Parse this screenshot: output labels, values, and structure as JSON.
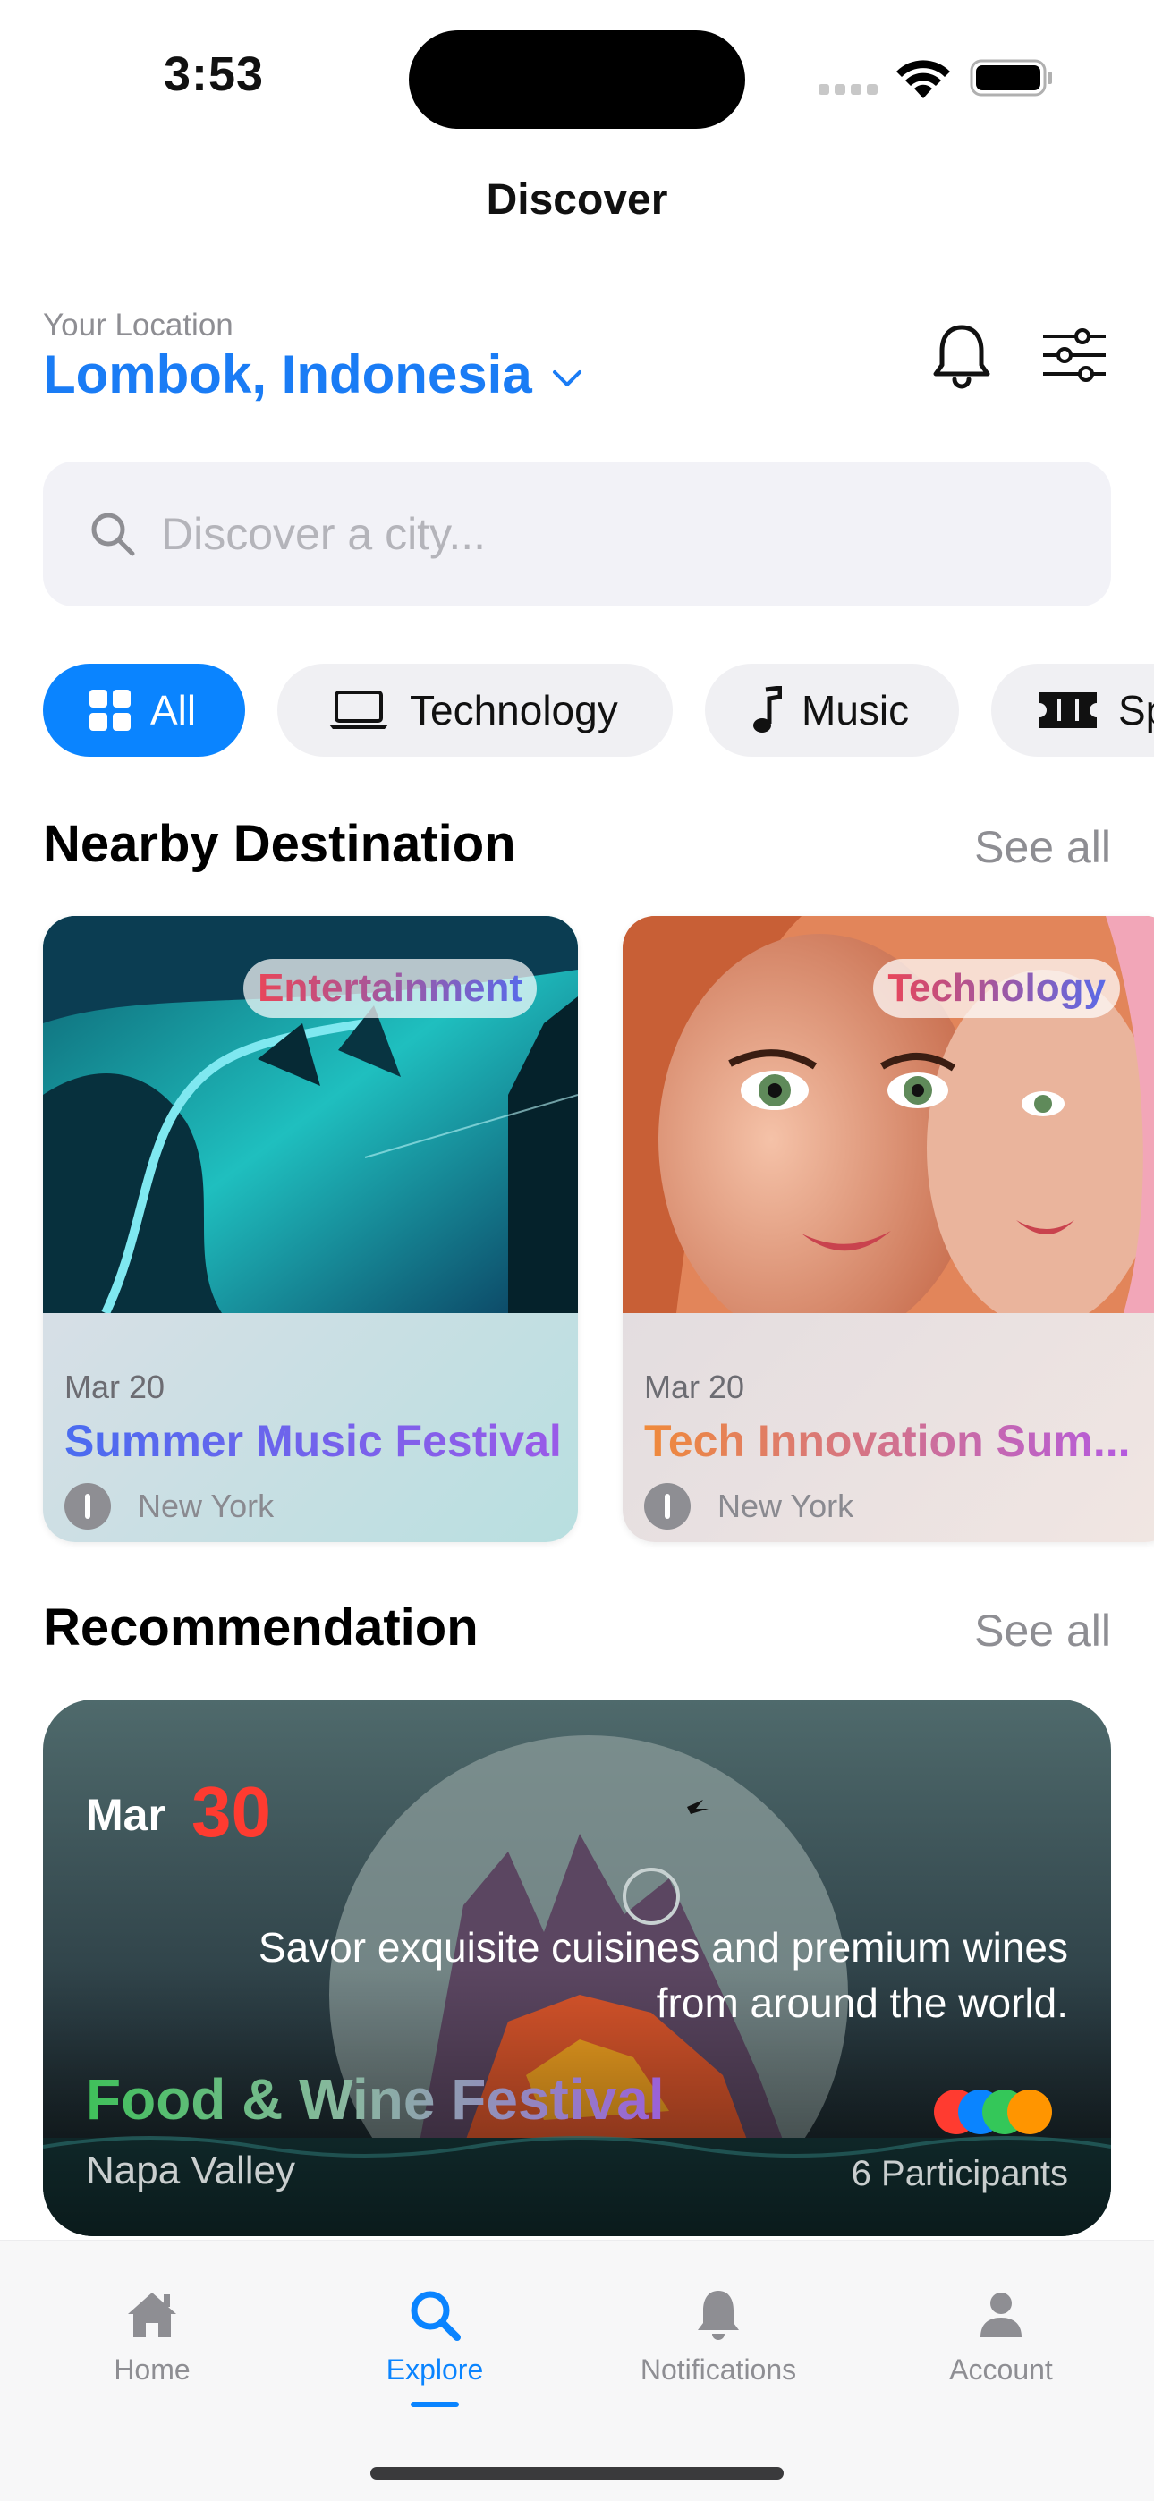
{
  "status_bar": {
    "time": "3:53"
  },
  "nav": {
    "title": "Discover"
  },
  "location": {
    "caption": "Your Location",
    "value": "Lombok, Indonesia"
  },
  "search": {
    "placeholder": "Discover a city..."
  },
  "categories": [
    {
      "label": "All",
      "icon": "grid-icon",
      "active": true
    },
    {
      "label": "Technology",
      "icon": "laptop-icon",
      "active": false
    },
    {
      "label": "Music",
      "icon": "music-note-icon",
      "active": false
    },
    {
      "label": "Sp",
      "icon": "ticket-icon",
      "active": false
    }
  ],
  "nearby": {
    "title": "Nearby Destination",
    "see_all": "See all",
    "cards": [
      {
        "badge": "Entertainment",
        "date": "Mar 20",
        "name": "Summer Music Festival",
        "location": "New York"
      },
      {
        "badge": "Technology",
        "date": "Mar 20",
        "name": "Tech Innovation Sum...",
        "location": "New York"
      }
    ]
  },
  "recommendation": {
    "title": "Recommendation",
    "see_all": "See all",
    "card": {
      "month": "Mar",
      "day": "30",
      "description_line1": "Savor exquisite cuisines and premium wines",
      "description_line2": "from around the world.",
      "event_title": "Food & Wine Festival",
      "place": "Napa Valley",
      "participants": "6 Participants",
      "avatar_colors": [
        "#ff3b30",
        "#0a84ff",
        "#34c759",
        "#ff9500"
      ]
    }
  },
  "tabbar": {
    "items": [
      {
        "label": "Home",
        "icon": "house-icon",
        "active": false
      },
      {
        "label": "Explore",
        "icon": "magnifier-icon",
        "active": true
      },
      {
        "label": "Notifications",
        "icon": "bell-icon",
        "active": false
      },
      {
        "label": "Account",
        "icon": "person-icon",
        "active": false
      }
    ]
  },
  "colors": {
    "accent": "#0a84ff",
    "location_text": "#1a7cf5",
    "date_day": "#ff3b30"
  }
}
